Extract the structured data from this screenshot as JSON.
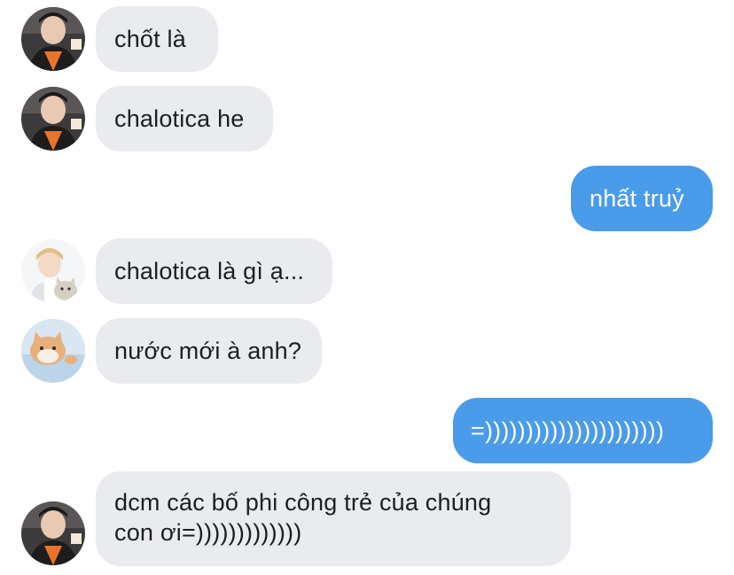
{
  "colors": {
    "incoming_bubble": "#e9ebee",
    "outgoing_bubble": "#4a9be9",
    "incoming_text": "#1c1e21",
    "outgoing_text": "#ffffff"
  },
  "messages": [
    {
      "direction": "incoming",
      "sender_avatar": "avatar-boy-orange-shirt",
      "text": "chốt là"
    },
    {
      "direction": "incoming",
      "sender_avatar": "avatar-boy-orange-shirt",
      "text": "chalotica he"
    },
    {
      "direction": "outgoing",
      "text": "nhất truỷ"
    },
    {
      "direction": "incoming",
      "sender_avatar": "avatar-boy-with-cat",
      "text": "chalotica là gì ạ..."
    },
    {
      "direction": "incoming",
      "sender_avatar": "avatar-cat-photo",
      "text": "nước mới à anh?"
    },
    {
      "direction": "outgoing",
      "text": "=))))))))))))))))))))))"
    },
    {
      "direction": "incoming",
      "sender_avatar": "avatar-boy-orange-shirt",
      "text_line1": "dcm các bố phi công trẻ của chúng",
      "text_line2": "con ơi=)))))))))))))"
    }
  ]
}
